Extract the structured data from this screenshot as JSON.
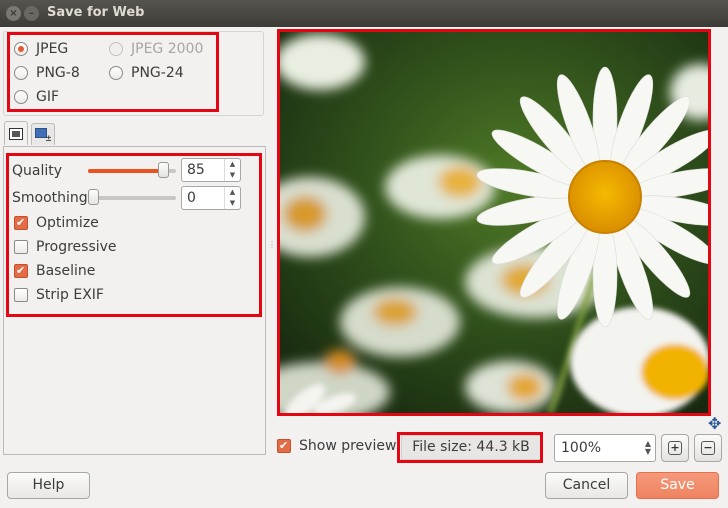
{
  "window": {
    "title": "Save for Web"
  },
  "format": {
    "options": [
      {
        "label": "JPEG",
        "checked": true,
        "disabled": false
      },
      {
        "label": "JPEG 2000",
        "checked": false,
        "disabled": true
      },
      {
        "label": "PNG-8",
        "checked": false,
        "disabled": false
      },
      {
        "label": "PNG-24",
        "checked": false,
        "disabled": false
      },
      {
        "label": "GIF",
        "checked": false,
        "disabled": false
      }
    ]
  },
  "tabs": [
    {
      "icon": "image-settings-icon",
      "active": true
    },
    {
      "icon": "image-resize-icon",
      "active": false
    }
  ],
  "options": {
    "quality_label": "Quality",
    "quality_value": "85",
    "quality_level": 0.85,
    "smoothing_label": "Smoothing",
    "smoothing_value": "0",
    "smoothing_level": 0,
    "checks": [
      {
        "label": "Optimize",
        "checked": true
      },
      {
        "label": "Progressive",
        "checked": false
      },
      {
        "label": "Baseline",
        "checked": true
      },
      {
        "label": "Strip EXIF",
        "checked": false
      }
    ]
  },
  "preview": {
    "show_label": "Show preview",
    "show_checked": true,
    "file_size": "File size: 44.3 kB",
    "zoom": "100%"
  },
  "buttons": {
    "help": "Help",
    "cancel": "Cancel",
    "save": "Save"
  },
  "colors": {
    "accent": "#e95420",
    "annotation": "#e30613",
    "titlebar": "#3c3b37"
  }
}
